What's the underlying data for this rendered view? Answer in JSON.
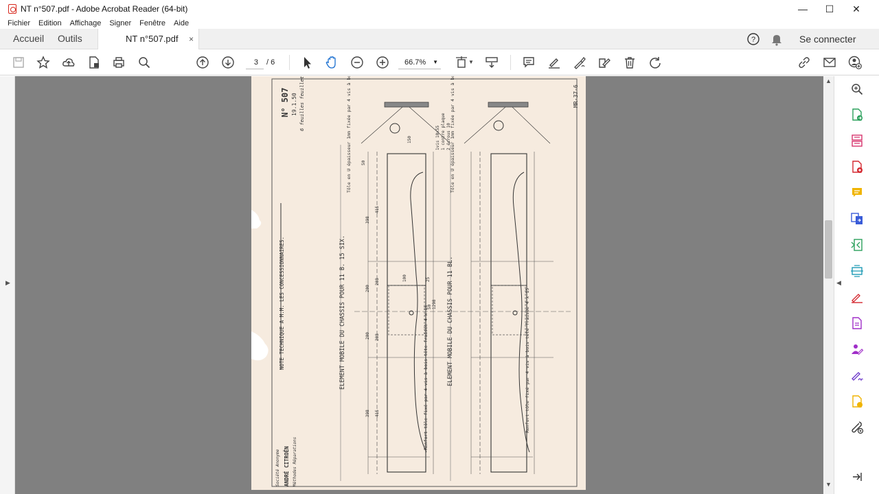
{
  "window": {
    "title": "NT n°507.pdf - Adobe Acrobat Reader (64-bit)",
    "minimize": "—",
    "maximize": "☐",
    "close": "✕"
  },
  "menu": [
    "Fichier",
    "Edition",
    "Affichage",
    "Signer",
    "Fenêtre",
    "Aide"
  ],
  "tabs": {
    "home": "Accueil",
    "tools": "Outils",
    "document": "NT n°507.pdf",
    "close": "×"
  },
  "account": {
    "help_icon": "help-icon",
    "bell_icon": "bell-icon",
    "sign_in": "Se connecter"
  },
  "toolbar": {
    "page_current": "3",
    "page_total": "/ 6",
    "zoom": "66.7%"
  },
  "document": {
    "ref": "MR-37-6",
    "no": "N° 507",
    "date": "19.1.50",
    "feuillets": "6 feuilles feuillet n°4",
    "note": "NOTE TECHNIQUE A M.M. LES CONCESSIONNAIRES.",
    "title1": "ELEMENT MOBILE DU CHASSIS POUR 11 B. 15 SIX.",
    "title2": "ELEMENT MOBILE DU CHASSIS POUR 11 BL.",
    "tole1": "Tôle en U épaisseur 1mm fixée par 4 vis à bois tête fraisée 4 x 15 de chaque côté",
    "tole2": "Tôle en U épaisseur 1mm fixée par 4 vis à bois tête fraisée 4 x 15 de chaque côté",
    "renfort1": "Renfort tôle fixé par 4 vis à bois tête fraisée 4 x 15",
    "renfort2": "Renfort tôle fixé par 4 vis à bois tête fraisée 4 x 15",
    "company": "Société Anonyme",
    "company_name": "ANDRÉ CITROËN",
    "department": "Méthodes Réparations",
    "dims": [
      "50",
      "415",
      "398",
      "100",
      "25",
      "208",
      "200",
      "200",
      "208",
      "50",
      "1298",
      "398",
      "415",
      "150",
      "1vis 10x55",
      "1 contre plaque",
      "2 écrous 10"
    ]
  }
}
